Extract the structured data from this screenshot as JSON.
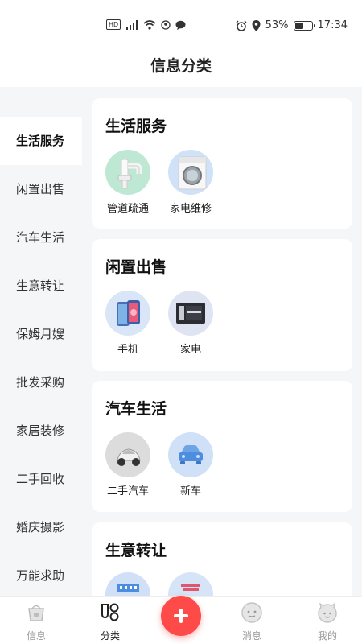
{
  "status": {
    "left_glyphs": "HD ⁴ᴳ",
    "battery": "53%",
    "battery_level": 0.53,
    "time": "17:34"
  },
  "header": {
    "title": "信息分类"
  },
  "sidebar": {
    "items": [
      {
        "label": "生活服务"
      },
      {
        "label": "闲置出售"
      },
      {
        "label": "汽车生活"
      },
      {
        "label": "生意转让"
      },
      {
        "label": "保姆月嫂"
      },
      {
        "label": "批发采购"
      },
      {
        "label": "家居装修"
      },
      {
        "label": "二手回收"
      },
      {
        "label": "婚庆摄影"
      },
      {
        "label": "万能求助"
      }
    ]
  },
  "sections": [
    {
      "title": "生活服务",
      "items": [
        {
          "label": "管道疏通",
          "icon": "pipe-icon"
        },
        {
          "label": "家电维修",
          "icon": "washing-machine-icon"
        }
      ]
    },
    {
      "title": "闲置出售",
      "items": [
        {
          "label": "手机",
          "icon": "phone-icon"
        },
        {
          "label": "家电",
          "icon": "appliance-icon"
        }
      ]
    },
    {
      "title": "汽车生活",
      "items": [
        {
          "label": "二手汽车",
          "icon": "used-car-icon"
        },
        {
          "label": "新车",
          "icon": "new-car-icon"
        }
      ]
    },
    {
      "title": "生意转让",
      "items": [
        {
          "label": "",
          "icon": "shop-icon"
        },
        {
          "label": "",
          "icon": "store-icon"
        }
      ]
    }
  ],
  "tabbar": {
    "tabs": [
      {
        "label": "信息",
        "icon": "info-basket-icon"
      },
      {
        "label": "分类",
        "icon": "category-icon"
      },
      {
        "label": "消息",
        "icon": "message-face-icon"
      },
      {
        "label": "我的",
        "icon": "profile-face-icon"
      }
    ],
    "publish_icon": "plus-icon"
  },
  "colors": {
    "accent": "#ff4a4a",
    "background": "#f5f6f8",
    "card": "#ffffff"
  }
}
